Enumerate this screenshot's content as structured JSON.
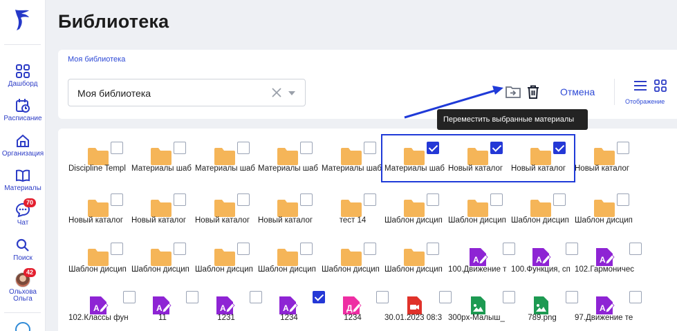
{
  "colors": {
    "accent": "#2d49d6",
    "folder": "#f5b558",
    "checkbox_checked": "#2438d6",
    "badge": "#e3202f",
    "doc_purple": "#8e24d4",
    "doc_pink": "#ee2ea3",
    "video_red": "#e0322a",
    "image_green": "#1d9a52"
  },
  "header": {
    "title": "Библиотека"
  },
  "sidebar": {
    "items": [
      {
        "label": "Дашборд",
        "icon": "dashboard-icon"
      },
      {
        "label": "Расписание",
        "icon": "calendar-icon"
      },
      {
        "label": "Организация",
        "icon": "organization-icon"
      },
      {
        "label": "Материалы",
        "icon": "book-icon"
      },
      {
        "label": "Чат",
        "icon": "chat-icon",
        "badge": "70"
      },
      {
        "label": "Поиск",
        "icon": "search-icon"
      },
      {
        "label": "Ольхова Ольга",
        "icon": "avatar",
        "badge": "42"
      }
    ]
  },
  "toolbar": {
    "breadcrumb": "Моя библиотека",
    "select_value": "Моя библиотека",
    "cancel_label": "Отмена",
    "view_label": "Отображение",
    "tooltip": "Переместить выбранные материалы"
  },
  "items": [
    {
      "label": "Discipline Templ",
      "type": "folder",
      "checked": false
    },
    {
      "label": "Материалы шаб",
      "type": "folder",
      "checked": false
    },
    {
      "label": "Материалы шаб",
      "type": "folder",
      "checked": false
    },
    {
      "label": "Материалы шаб",
      "type": "folder",
      "checked": false
    },
    {
      "label": "Материалы шаб",
      "type": "folder",
      "checked": false
    },
    {
      "label": "Материалы шаб",
      "type": "folder",
      "checked": true
    },
    {
      "label": "Новый каталог",
      "type": "folder",
      "checked": true
    },
    {
      "label": "Новый каталог",
      "type": "folder",
      "checked": true
    },
    {
      "label": "Новый каталог",
      "type": "folder",
      "checked": false
    },
    {
      "label": "Новый каталог",
      "type": "folder",
      "checked": false
    },
    {
      "label": "Новый каталог",
      "type": "folder",
      "checked": false
    },
    {
      "label": "Новый каталог",
      "type": "folder",
      "checked": false
    },
    {
      "label": "Новый каталог",
      "type": "folder",
      "checked": false
    },
    {
      "label": "тест 14",
      "type": "folder",
      "checked": false
    },
    {
      "label": "Шаблон дисцип",
      "type": "folder",
      "checked": false
    },
    {
      "label": "Шаблон дисцип",
      "type": "folder",
      "checked": false
    },
    {
      "label": "Шаблон дисцип",
      "type": "folder",
      "checked": false
    },
    {
      "label": "Шаблон дисцип",
      "type": "folder",
      "checked": false
    },
    {
      "label": "Шаблон дисцип",
      "type": "folder",
      "checked": false
    },
    {
      "label": "Шаблон дисцип",
      "type": "folder",
      "checked": false
    },
    {
      "label": "Шаблон дисцип",
      "type": "folder",
      "checked": false
    },
    {
      "label": "Шаблон дисцип",
      "type": "folder",
      "checked": false
    },
    {
      "label": "Шаблон дисцип",
      "type": "folder",
      "checked": false
    },
    {
      "label": "Шаблон дисцип",
      "type": "folder",
      "checked": false
    },
    {
      "label": "100.Движение т",
      "type": "doc",
      "checked": false
    },
    {
      "label": "100.Функция, сп",
      "type": "doc",
      "checked": false
    },
    {
      "label": "102.Гармоничес",
      "type": "doc",
      "checked": false
    },
    {
      "label": "102.Классы фун",
      "type": "doc",
      "checked": false
    },
    {
      "label": "11",
      "type": "doc",
      "checked": false
    },
    {
      "label": "1231",
      "type": "doc",
      "checked": false
    },
    {
      "label": "1234",
      "type": "doc",
      "checked": true
    },
    {
      "label": "1234",
      "type": "doc-pink",
      "checked": false
    },
    {
      "label": "30.01.2023 08:3",
      "type": "video",
      "checked": false
    },
    {
      "label": "300px-Малыш_",
      "type": "image",
      "checked": false
    },
    {
      "label": "789.png",
      "type": "image",
      "checked": false
    },
    {
      "label": "97.Движение те",
      "type": "doc",
      "checked": false
    }
  ]
}
